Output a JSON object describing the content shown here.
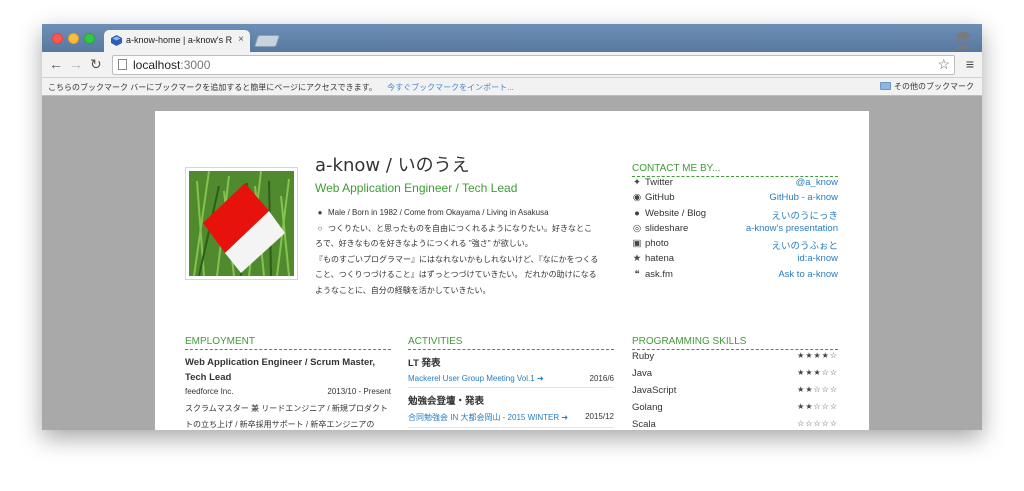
{
  "browser": {
    "tab_title": "a-know-home | a-know's R",
    "tab_close": "×",
    "url_host": "localhost",
    "url_port": ":3000",
    "bookmark_hint": "こちらのブックマーク バーにブックマークを追加すると簡単にページにアクセスできます。",
    "bookmark_import": "今すぐブックマークをインポート...",
    "other_bookmarks": "その他のブックマーク",
    "icons": {
      "back": "arrow-left-icon",
      "forward": "arrow-right-icon",
      "reload": "reload-icon",
      "star": "star-icon",
      "menu": "hamburger-menu-icon"
    }
  },
  "profile": {
    "name": "a-know / いのうえ",
    "role": "Web Application Engineer / Tech Lead",
    "meta": "Male / Born in 1982 / Come from Okayama / Living in Asakusa",
    "bio_lines": [
      "つくりたい、と思ったものを自由につくれるようになりたい。好きなとこ",
      "ろで、好きなものを好きなようにつくれる \"強さ\" が欲しい。",
      "『ものすごいプログラマー』にはなれないかもしれないけど、『なにかをつくる",
      "こと、つくりつづけること』はずっとつづけていきたい。 だれかの助けになる",
      "ようなことに、自分の経験を活かしていきたい。"
    ]
  },
  "contact": {
    "title": "CONTACT ME BY...",
    "items": [
      {
        "label": "Twitter",
        "value": "@a_know",
        "icon": "twitter-icon"
      },
      {
        "label": "GitHub",
        "value": "GitHub - a-know",
        "icon": "github-icon"
      },
      {
        "label": "Website / Blog",
        "value": "えいのうにっき",
        "icon": "globe-icon"
      },
      {
        "label": "slideshare",
        "value": "a-know's presentation",
        "icon": "slideshare-icon"
      },
      {
        "label": "photo",
        "value": "えいのうふぉと",
        "icon": "camera-icon"
      },
      {
        "label": "hatena",
        "value": "id:a-know",
        "icon": "star-icon"
      },
      {
        "label": "ask.fm",
        "value": "Ask to a-know",
        "icon": "comments-icon"
      }
    ]
  },
  "employment": {
    "title": "EMPLOYMENT",
    "job_title_line1": "Web Application Engineer / Scrum Master,",
    "job_title_line2": "Tech Lead",
    "company": "feedforce Inc.",
    "period": "2013/10 - Present",
    "desc_line1": "スクラムマスター 兼 リードエンジニア / 新規プロダクト",
    "desc_line2": "トの立ち上げ / 新卒採用サポート / 新卒エンジニアの"
  },
  "activities": {
    "title": "ACTIVITIES",
    "groups": [
      {
        "label": "LT 発表",
        "item": "Mackerel User Group Meeting Vol.1",
        "date": "2016/6"
      },
      {
        "label": "勉強会登壇・発表",
        "item": "合同勉強会 IN 大都会岡山 - 2015 WINTER",
        "date": "2015/12"
      }
    ]
  },
  "skills": {
    "title": "PROGRAMMING SKILLS",
    "items": [
      {
        "name": "Ruby",
        "stars": "★★★★☆",
        "level": 4
      },
      {
        "name": "Java",
        "stars": "★★★☆☆",
        "level": 3
      },
      {
        "name": "JavaScript",
        "stars": "★★☆☆☆",
        "level": 2
      },
      {
        "name": "Golang",
        "stars": "★★☆☆☆",
        "level": 2
      },
      {
        "name": "Scala",
        "stars": "☆☆☆☆☆",
        "level": 0
      }
    ]
  }
}
